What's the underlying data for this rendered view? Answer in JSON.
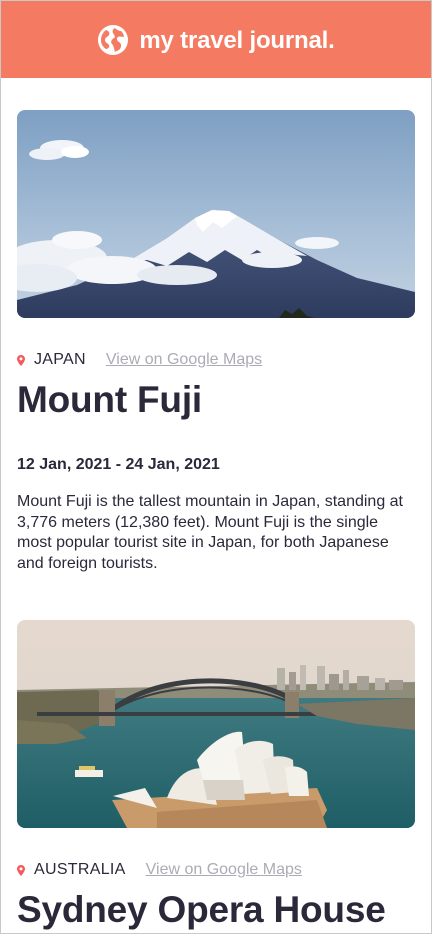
{
  "header": {
    "title": "my travel journal.",
    "icon": "globe-icon",
    "background": "#f57a62"
  },
  "entries": [
    {
      "country": "JAPAN",
      "maps_link": "View on Google Maps",
      "title": "Mount Fuji",
      "dates": "12 Jan, 2021 - 24 Jan, 2021",
      "description": "Mount Fuji is the tallest mountain in Japan, standing at 3,776 meters (12,380 feet). Mount Fuji is the single most popular tourist site in Japan, for both Japanese and foreign tourists."
    },
    {
      "country": "AUSTRALIA",
      "maps_link": "View on Google Maps",
      "title": "Sydney Opera House"
    }
  ],
  "colors": {
    "accent": "#f57a62",
    "text": "#2b283a",
    "muted": "#918e9b",
    "pin": "#f55a5a"
  }
}
